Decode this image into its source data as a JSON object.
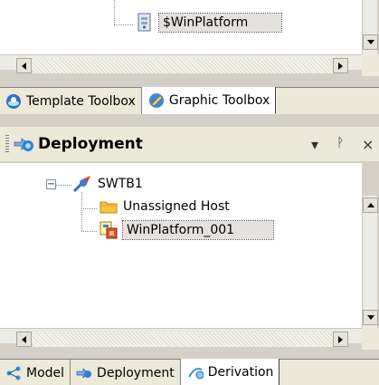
{
  "top_tree": {
    "item": "$WinPlatform"
  },
  "top_tabs": [
    {
      "label": "Template Toolbox",
      "mnemonic": "T",
      "icon": "template-toolbox-icon"
    },
    {
      "label": "Graphic Toolbox",
      "mnemonic": "p",
      "icon": "graphic-toolbox-icon"
    }
  ],
  "deployment": {
    "title": "Deployment",
    "dropdown_glyph": "▾",
    "pin_glyph": "ᚹ",
    "close_glyph": "×",
    "tree": {
      "root": "SWTB1",
      "expander": "−",
      "children": [
        "Unassigned Host",
        "WinPlatform_001"
      ]
    }
  },
  "bottom_tabs": [
    {
      "label": "Model",
      "icon": "model-icon"
    },
    {
      "label": "Deployment",
      "icon": "deployment-icon"
    },
    {
      "label": "Derivation",
      "icon": "derivation-icon"
    }
  ],
  "colors": {
    "chrome": "#ece9d8",
    "selection": "#e4e2dc",
    "folder": "#f5c542",
    "gallery_blue": "#3a7bd5"
  }
}
